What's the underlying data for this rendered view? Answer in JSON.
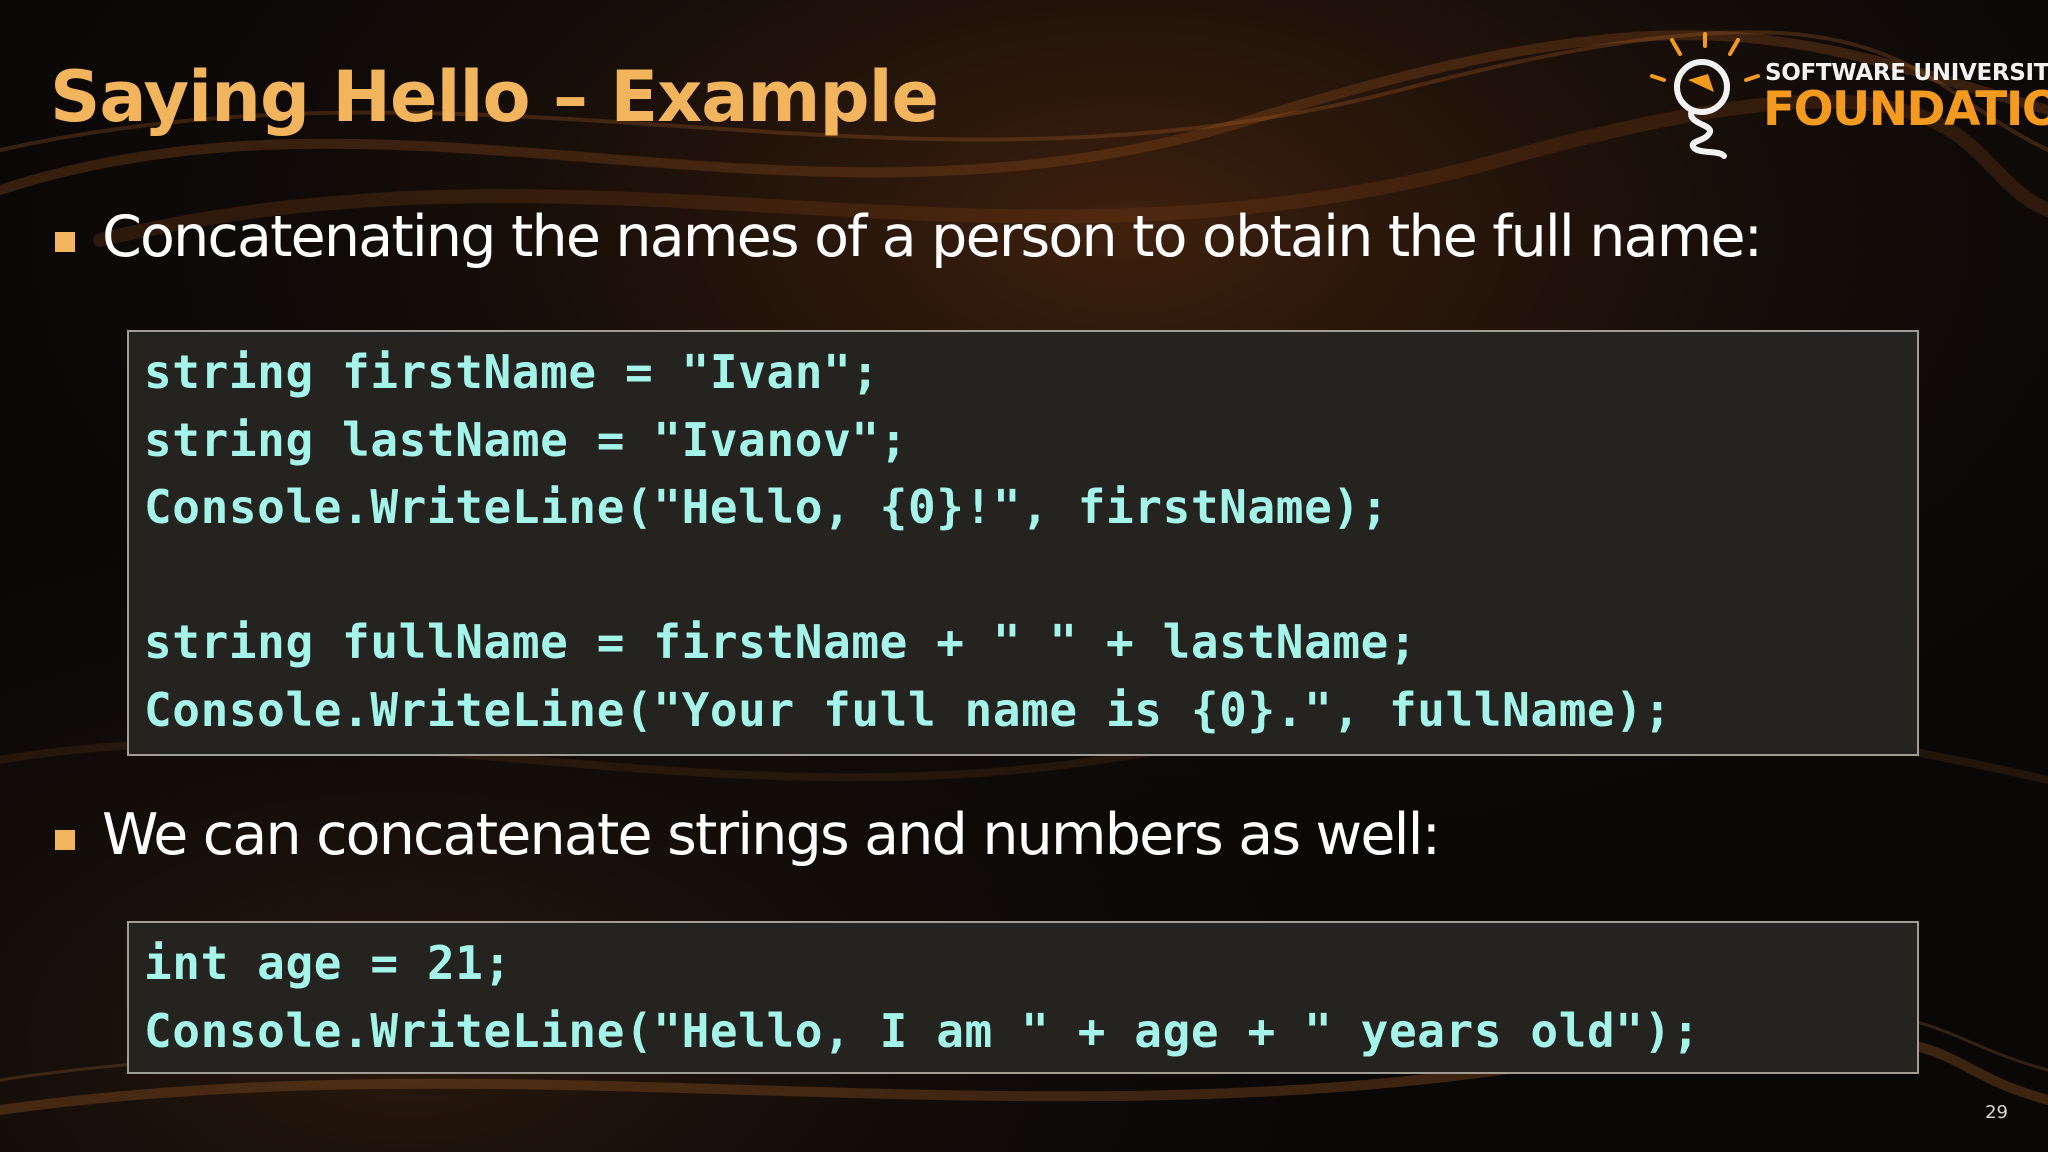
{
  "slide": {
    "title": "Saying Hello – Example",
    "page_number": "29"
  },
  "logo": {
    "line1": "SOFTWARE UNIVERSITY",
    "line2": "FOUNDATION"
  },
  "bullets": [
    "Concatenating the names of a person to obtain the full name:",
    "We can concatenate strings and numbers as well:"
  ],
  "code_blocks": [
    {
      "lines": [
        "string firstName = \"Ivan\";",
        "string lastName = \"Ivanov\";",
        "Console.WriteLine(\"Hello, {0}!\", firstName);",
        "",
        "string fullName = firstName + \" \" + lastName;",
        "Console.WriteLine(\"Your full name is {0}.\", fullName);"
      ]
    },
    {
      "lines": [
        "int age = 21;",
        "Console.WriteLine(\"Hello, I am \" + age + \" years old\");"
      ]
    }
  ],
  "colors": {
    "title": "#f2b45c",
    "bullet_marker": "#f2b45c",
    "code_text": "#a5f4ea",
    "code_background": "#252320",
    "logo_accent": "#f39a1f"
  }
}
